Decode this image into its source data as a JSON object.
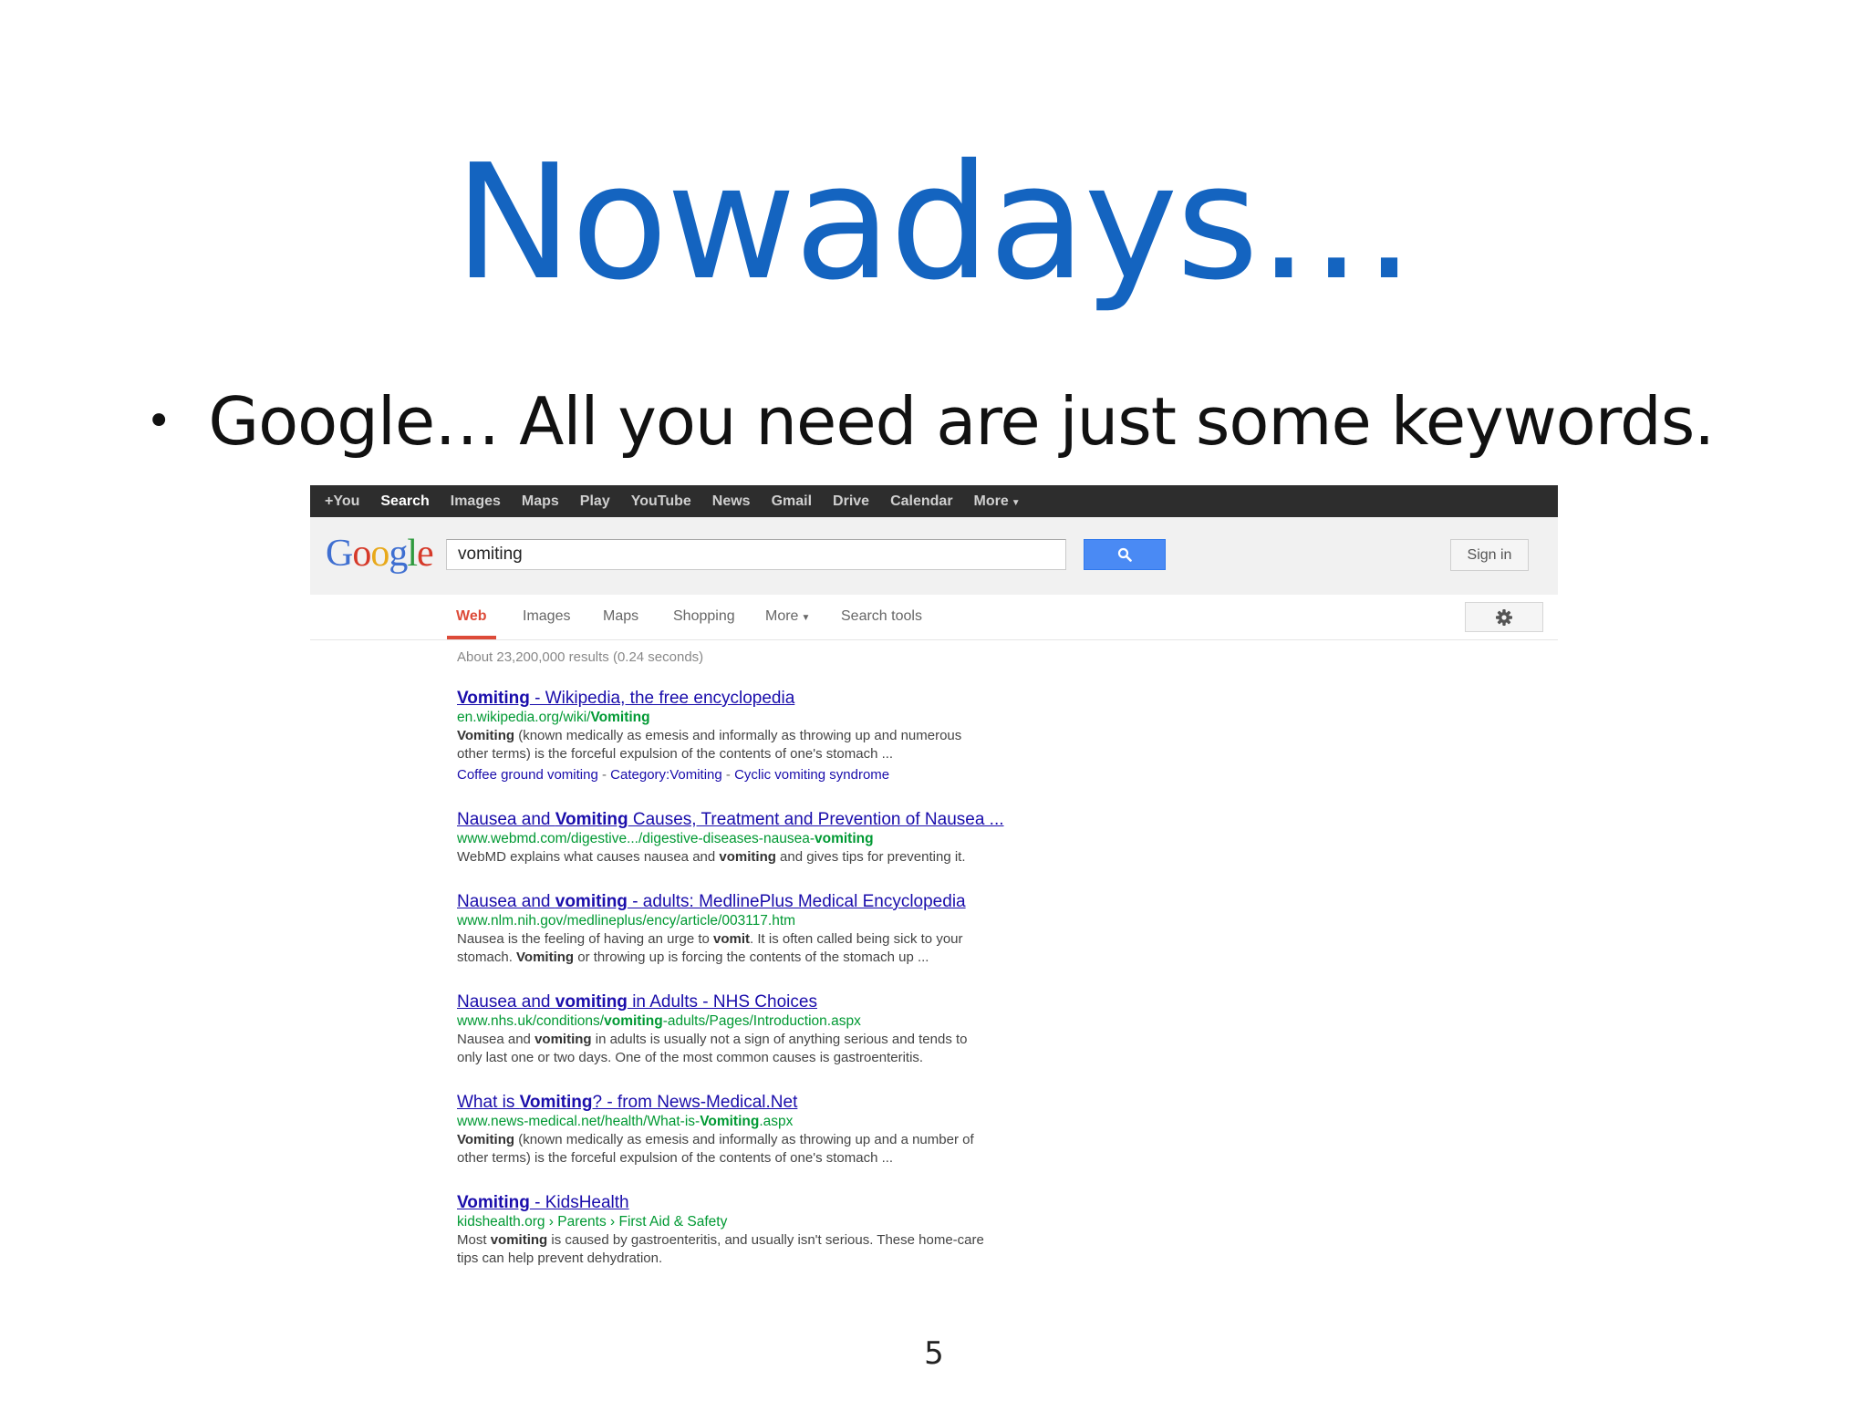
{
  "slide": {
    "title": "Nowadays…",
    "bullet": "Google… All you need are just some keywords.",
    "page_number": "5"
  },
  "google": {
    "topbar": [
      "+You",
      "Search",
      "Images",
      "Maps",
      "Play",
      "YouTube",
      "News",
      "Gmail",
      "Drive",
      "Calendar",
      "More"
    ],
    "active_topbar": "Search",
    "search_value": "vomiting",
    "sign_in": "Sign in",
    "tabs": [
      "Web",
      "Images",
      "Maps",
      "Shopping",
      "More",
      "Search tools"
    ],
    "active_tab": "Web",
    "stats": "About 23,200,000 results (0.24 seconds)",
    "results": [
      {
        "title": [
          {
            "t": "Vomiting",
            "b": true
          },
          {
            "t": " - Wikipedia, the free encyclopedia"
          }
        ],
        "url": [
          {
            "t": "en.wikipedia.org/wiki/"
          },
          {
            "t": "Vomiting",
            "b": true
          }
        ],
        "snippet": [
          [
            {
              "t": "Vomiting",
              "b": true
            },
            {
              "t": " (known medically as emesis and informally as throwing up and numerous"
            }
          ],
          [
            {
              "t": "other terms) is the forceful expulsion of the contents of one's stomach ..."
            }
          ]
        ],
        "links": [
          "Coffee ground vomiting",
          "Category:Vomiting",
          "Cyclic vomiting syndrome"
        ]
      },
      {
        "title": [
          {
            "t": "Nausea and "
          },
          {
            "t": "Vomiting",
            "b": true
          },
          {
            "t": " Causes, Treatment and Prevention of Nausea ..."
          }
        ],
        "url": [
          {
            "t": "www.webmd.com/digestive.../digestive-diseases-nausea-"
          },
          {
            "t": "vomiting",
            "b": true
          }
        ],
        "snippet": [
          [
            {
              "t": "WebMD explains what causes nausea and "
            },
            {
              "t": "vomiting",
              "b": true
            },
            {
              "t": " and gives tips for preventing it."
            }
          ]
        ]
      },
      {
        "title": [
          {
            "t": "Nausea and "
          },
          {
            "t": "vomiting",
            "b": true
          },
          {
            "t": " - adults: MedlinePlus Medical Encyclopedia"
          }
        ],
        "url": [
          {
            "t": "www.nlm.nih.gov/medlineplus/ency/article/003117.htm"
          }
        ],
        "snippet": [
          [
            {
              "t": "Nausea is the feeling of having an urge to "
            },
            {
              "t": "vomit",
              "b": true
            },
            {
              "t": ". It is often called being sick to your"
            }
          ],
          [
            {
              "t": "stomach. "
            },
            {
              "t": "Vomiting",
              "b": true
            },
            {
              "t": " or throwing up is forcing the contents of the stomach up ..."
            }
          ]
        ]
      },
      {
        "title": [
          {
            "t": "Nausea and "
          },
          {
            "t": "vomiting",
            "b": true
          },
          {
            "t": " in Adults - NHS Choices"
          }
        ],
        "url": [
          {
            "t": "www.nhs.uk/conditions/"
          },
          {
            "t": "vomiting",
            "b": true
          },
          {
            "t": "-adults/Pages/Introduction.aspx"
          }
        ],
        "snippet": [
          [
            {
              "t": "Nausea and "
            },
            {
              "t": "vomiting",
              "b": true
            },
            {
              "t": " in adults is usually not a sign of anything serious and tends to"
            }
          ],
          [
            {
              "t": "only last one or two days. One of the most common causes is gastroenteritis."
            }
          ]
        ]
      },
      {
        "title": [
          {
            "t": "What is "
          },
          {
            "t": "Vomiting",
            "b": true
          },
          {
            "t": "? - from News-Medical.Net"
          }
        ],
        "url": [
          {
            "t": "www.news-medical.net/health/What-is-"
          },
          {
            "t": "Vomiting",
            "b": true
          },
          {
            "t": ".aspx"
          }
        ],
        "snippet": [
          [
            {
              "t": "Vomiting",
              "b": true
            },
            {
              "t": " (known medically as emesis and informally as throwing up and a number of"
            }
          ],
          [
            {
              "t": "other terms) is the forceful expulsion of the contents of one's stomach ..."
            }
          ]
        ]
      },
      {
        "title": [
          {
            "t": "Vomiting",
            "b": true
          },
          {
            "t": " - KidsHealth"
          }
        ],
        "url": [
          {
            "t": "kidshealth.org › Parents › First Aid & Safety"
          }
        ],
        "snippet": [
          [
            {
              "t": "Most "
            },
            {
              "t": "vomiting",
              "b": true
            },
            {
              "t": " is caused by gastroenteritis, and usually isn't serious. These home-care"
            }
          ],
          [
            {
              "t": "tips can help prevent dehydration."
            }
          ]
        ]
      }
    ]
  },
  "colors": {
    "slide_title": "#1464c0",
    "topbar_bg": "#2d2d2d",
    "link": "#1a0dab",
    "url_green": "#009933",
    "active_tab": "#dd4b39",
    "search_button": "#4a8af4"
  },
  "icons": {
    "search_button": "magnifier-icon",
    "settings": "gear-icon",
    "dropdown": "caret-down-icon"
  }
}
